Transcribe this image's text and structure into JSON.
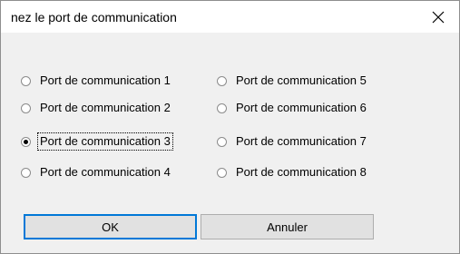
{
  "dialog": {
    "title": "nez le port de communication",
    "close_glyph": "×"
  },
  "ports": [
    {
      "label": "Port de communication 1",
      "checked": false
    },
    {
      "label": "Port de communication 2",
      "checked": false
    },
    {
      "label": "Port de communication 3",
      "checked": true
    },
    {
      "label": "Port de communication 4",
      "checked": false
    },
    {
      "label": "Port de communication 5",
      "checked": false
    },
    {
      "label": "Port de communication 6",
      "checked": false
    },
    {
      "label": "Port de communication 7",
      "checked": false
    },
    {
      "label": "Port de communication 8",
      "checked": false
    }
  ],
  "buttons": {
    "ok_label": "OK",
    "cancel_label": "Annuler"
  },
  "colors": {
    "dialog_background": "#f0f0f0",
    "titlebar_background": "#ffffff",
    "default_button_border": "#0078d7"
  }
}
